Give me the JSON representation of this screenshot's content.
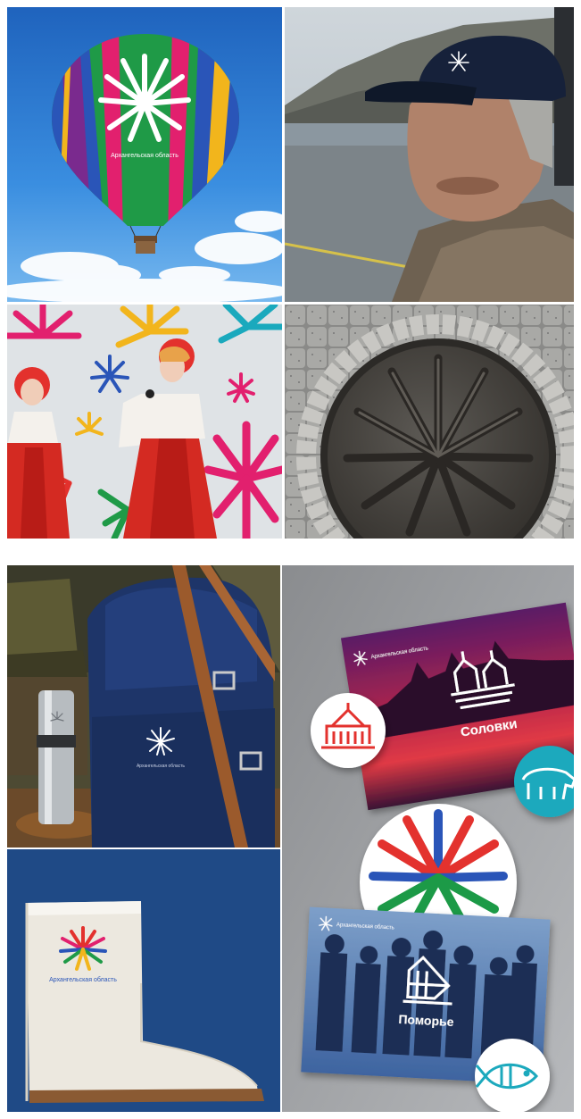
{
  "collage_top": {
    "balloon": {
      "logo_text": "Архангельская область"
    },
    "man": {},
    "singers": {},
    "manhole": {}
  },
  "collage_bottom": {
    "backpack": {
      "logo_text": "Архангельская область"
    },
    "boot": {
      "logo_text": "Архангельская область"
    },
    "cards": {
      "card_solovki": {
        "header": "Архангельская область",
        "title": "Соловки"
      },
      "card_pomorye": {
        "header": "Архангельская область",
        "title": "Поморье"
      }
    }
  },
  "colors": {
    "sky_blue": "#2f7fd0",
    "navy": "#1c3d78",
    "brand_red": "#e3312d",
    "brand_pink": "#e2206e",
    "brand_blue": "#2a55b8",
    "brand_green": "#1f9a47",
    "brand_yellow": "#f2b51c",
    "teal": "#1aa9bd"
  }
}
